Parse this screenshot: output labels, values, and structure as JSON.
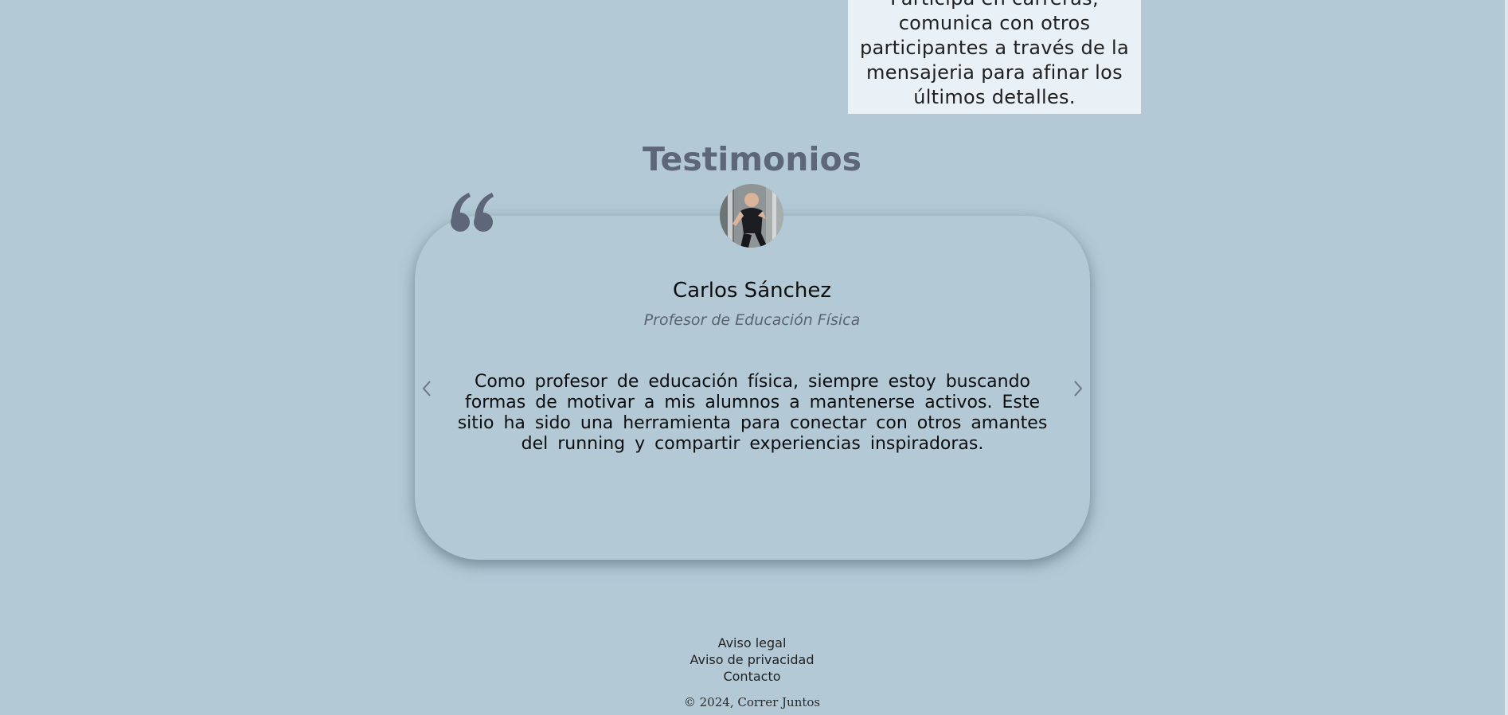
{
  "feature": {
    "partial_line": "Participa en carreras,",
    "line2": "comunica con otros",
    "line3": "participantes a través de la",
    "line4": "mensajeria para afinar los",
    "line5": "últimos detalles."
  },
  "testimonials": {
    "title": "Testimonios",
    "current": {
      "name": "Carlos Sánchez",
      "role": "Profesor de Educación Física",
      "text": "Como profesor de educación física, siempre estoy buscando formas de motivar a mis alumnos a mantenerse activos. Este sitio ha sido una herramienta para conectar con otros amantes del running y compartir experiencias inspiradoras."
    },
    "quote_icon": "quote-icon",
    "prev_icon": "chevron-left-icon",
    "next_icon": "chevron-right-icon"
  },
  "footer": {
    "links": [
      "Aviso legal",
      "Aviso de privacidad",
      "Contacto"
    ],
    "copyright": "© 2024, Correr Juntos"
  },
  "colors": {
    "background": "#b3cad6",
    "card_light": "#e9f1f6",
    "title": "#5e6779",
    "quote": "#5e6779"
  }
}
